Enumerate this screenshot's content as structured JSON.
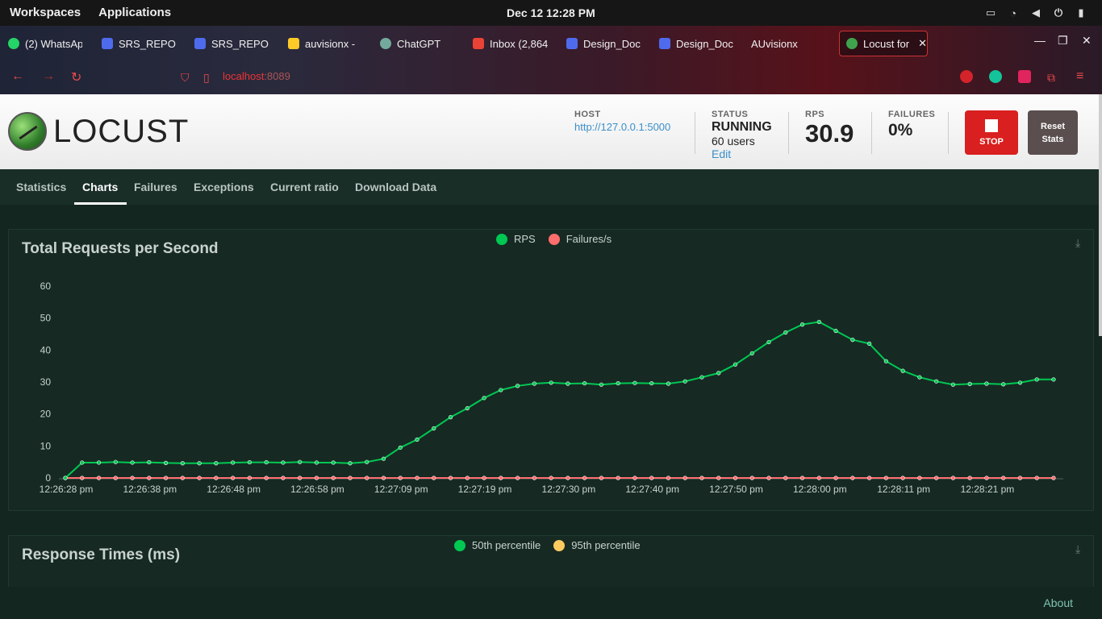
{
  "system": {
    "workspaces": "Workspaces",
    "applications": "Applications",
    "clock": "Dec 12  12:28 PM"
  },
  "browser": {
    "tabs": [
      {
        "label": "(2) WhatsAp",
        "icon": "whatsapp-icon",
        "color": "#25d366"
      },
      {
        "label": "SRS_REPOR",
        "icon": "docs-icon",
        "color": "#4f6bed"
      },
      {
        "label": "SRS_REPOR",
        "icon": "docs-icon",
        "color": "#4f6bed"
      },
      {
        "label": "auvisionx -",
        "icon": "firebase-icon",
        "color": "#ffca28"
      },
      {
        "label": "ChatGPT",
        "icon": "chatgpt-icon",
        "color": "#74aa9c"
      },
      {
        "label": "Inbox (2,864",
        "icon": "gmail-icon",
        "color": "#ea4335"
      },
      {
        "label": "Design_Doc",
        "icon": "docs-icon",
        "color": "#4f6bed"
      },
      {
        "label": "Design_Doc",
        "icon": "docs-icon",
        "color": "#4f6bed"
      },
      {
        "label": "AUvisionx",
        "icon": "",
        "color": ""
      },
      {
        "label": "Locust for",
        "icon": "locust-icon",
        "color": "#3fa34d"
      }
    ],
    "url_host": "localhost",
    "url_port": ":8089"
  },
  "header": {
    "logo_text": "LOCUST",
    "host_label": "HOST",
    "host_value": "http://127.0.0.1:5000",
    "status_label": "STATUS",
    "status_value": "RUNNING",
    "users_value": "60 users",
    "edit_label": "Edit",
    "rps_label": "RPS",
    "rps_value": "30.9",
    "failures_label": "FAILURES",
    "failures_value": "0%",
    "stop_label": "STOP",
    "reset_label_1": "Reset",
    "reset_label_2": "Stats"
  },
  "nav": {
    "tabs": [
      "Statistics",
      "Charts",
      "Failures",
      "Exceptions",
      "Current ratio",
      "Download Data"
    ],
    "active": "Charts"
  },
  "panels": {
    "rps_title": "Total Requests per Second",
    "rt_title": "Response Times (ms)",
    "rps_legend": [
      "RPS",
      "Failures/s"
    ],
    "rt_legend": [
      "50th percentile",
      "95th percentile"
    ]
  },
  "colors": {
    "rps": "#00c853",
    "failures": "#ff6d6d",
    "p50": "#00c853",
    "p95": "#ffca5f"
  },
  "chart_data": {
    "type": "line",
    "title": "Total Requests per Second",
    "ylim": [
      0,
      60
    ],
    "yticks": [
      0,
      10,
      20,
      30,
      40,
      50,
      60
    ],
    "xtick_labels": [
      "12:26:28 pm",
      "12:26:38 pm",
      "12:26:48 pm",
      "12:26:58 pm",
      "12:27:09 pm",
      "12:27:19 pm",
      "12:27:30 pm",
      "12:27:40 pm",
      "12:27:50 pm",
      "12:28:00 pm",
      "12:28:11 pm",
      "12:28:21 pm"
    ],
    "series": [
      {
        "name": "RPS",
        "values": [
          0,
          4.8,
          4.8,
          5.0,
          4.8,
          4.9,
          4.7,
          4.6,
          4.6,
          4.6,
          4.8,
          4.9,
          4.9,
          4.8,
          5.0,
          4.8,
          4.8,
          4.6,
          5.0,
          6.0,
          9.5,
          12.0,
          15.5,
          19.0,
          21.8,
          25.0,
          27.5,
          28.8,
          29.5,
          29.8,
          29.5,
          29.6,
          29.2,
          29.6,
          29.7,
          29.6,
          29.5,
          30.2,
          31.5,
          32.8,
          35.5,
          39.0,
          42.5,
          45.5,
          48.0,
          48.8,
          46.0,
          43.2,
          42.0,
          36.5,
          33.5,
          31.5,
          30.2,
          29.2,
          29.4,
          29.5,
          29.3,
          29.8,
          30.8,
          30.8
        ]
      },
      {
        "name": "Failures/s",
        "values": [
          0,
          0,
          0,
          0,
          0,
          0,
          0,
          0,
          0,
          0,
          0,
          0,
          0,
          0,
          0,
          0,
          0,
          0,
          0,
          0,
          0,
          0,
          0,
          0,
          0,
          0,
          0,
          0,
          0,
          0,
          0,
          0,
          0,
          0,
          0,
          0,
          0,
          0,
          0,
          0,
          0,
          0,
          0,
          0,
          0,
          0,
          0,
          0,
          0,
          0,
          0,
          0,
          0,
          0,
          0,
          0,
          0,
          0,
          0,
          0
        ]
      }
    ]
  },
  "footer": {
    "about": "About"
  }
}
